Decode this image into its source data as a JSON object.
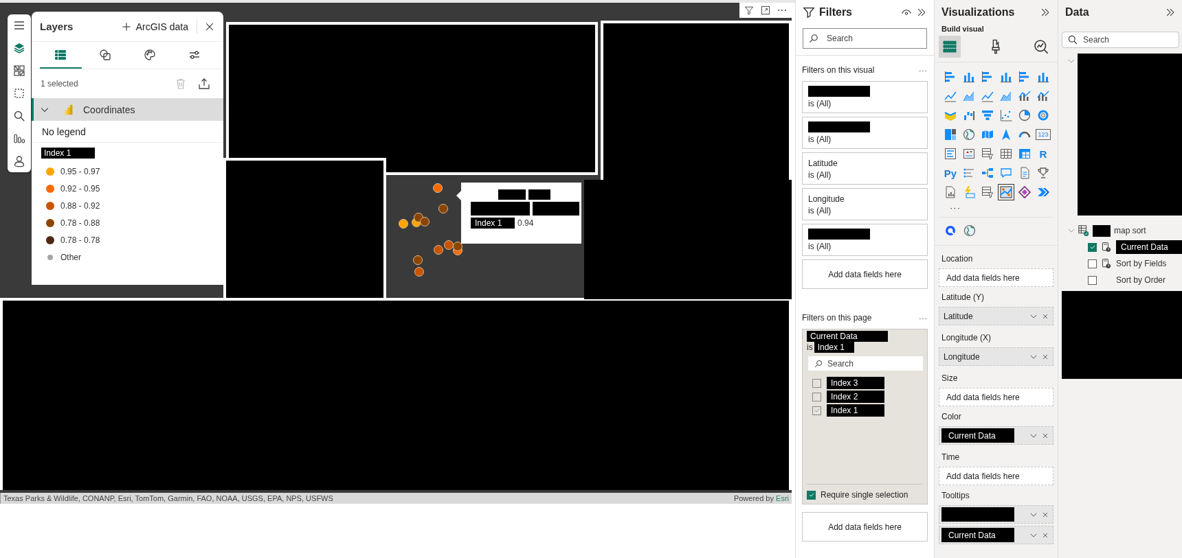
{
  "map_toolbar": [
    {
      "kind": "menu",
      "selected": false
    },
    {
      "kind": "layers",
      "selected": true
    },
    {
      "kind": "grid",
      "selected": false
    },
    {
      "kind": "select",
      "selected": false
    },
    {
      "kind": "search",
      "selected": false
    },
    {
      "kind": "bars",
      "selected": false
    },
    {
      "kind": "person",
      "selected": false
    }
  ],
  "layers_panel": {
    "title": "Layers",
    "add_button": "ArcGIS data",
    "tabs": [
      {
        "kind": "list",
        "selected": true
      },
      {
        "kind": "shapes",
        "selected": false
      },
      {
        "kind": "palette",
        "selected": false
      },
      {
        "kind": "sliders",
        "selected": false
      }
    ],
    "selection_count": "1 selected",
    "layer": {
      "name": "Coordinates",
      "expanded": true
    },
    "legend_note": "No legend",
    "legend_title": "Index 1",
    "legend_items": [
      {
        "label": "0.95 - 0.97",
        "color": "#ffa500"
      },
      {
        "label": "0.92 - 0.95",
        "color": "#ff6a00"
      },
      {
        "label": "0.88 - 0.92",
        "color": "#c85400"
      },
      {
        "label": "0.78 - 0.88",
        "color": "#8b4500"
      },
      {
        "label": "0.78 - 0.78",
        "color": "#4e2a14"
      },
      {
        "label": "Other",
        "color": "#a6a6a6"
      }
    ]
  },
  "tooltip": {
    "field": "Index 1",
    "value": "0.94"
  },
  "attribution": {
    "text": "Texas Parks & Wildlife, CONANP, Esri, TomTom, Garmin, FAO, NOAA, USGS, EPA, NPS, USFWS",
    "powered_by": "Powered by",
    "link": "Esri"
  },
  "filters": {
    "title": "Filters",
    "search_placeholder": "Search",
    "visual_section": "Filters on this visual",
    "visual_filters": [
      {
        "kind": "redacted",
        "condition": "is (All)"
      },
      {
        "kind": "redacted",
        "condition": "is (All)"
      },
      {
        "kind": "field",
        "field": "Latitude",
        "condition": "is (All)"
      },
      {
        "kind": "field",
        "field": "Longitude",
        "condition": "is (All)"
      },
      {
        "kind": "redacted",
        "condition": "is (All)"
      }
    ],
    "visual_add": "Add data fields here",
    "page_section": "Filters on this page",
    "page_filter": {
      "field": "Current Data",
      "is_label": "is",
      "value": "Index 1",
      "search_placeholder": "Search",
      "options": [
        {
          "label": "Index  3",
          "checked": false
        },
        {
          "label": "Index 2",
          "checked": false
        },
        {
          "label": "Index 1",
          "checked": true
        }
      ],
      "require_single": {
        "label": "Require single selection",
        "checked": true
      }
    },
    "page_add": "Add data fields here"
  },
  "visualizations": {
    "title": "Visualizations",
    "subtitle": "Build visual",
    "modes": [
      {
        "kind": "build",
        "selected": true
      },
      {
        "kind": "format",
        "selected": false
      },
      {
        "kind": "analytics",
        "selected": false
      }
    ],
    "visual_types": [
      {
        "kind": "hbar",
        "selected": false
      },
      {
        "kind": "vbar",
        "selected": false
      },
      {
        "kind": "hbar",
        "selected": false
      },
      {
        "kind": "vbar",
        "selected": false
      },
      {
        "kind": "hbar",
        "selected": false
      },
      {
        "kind": "vbar",
        "selected": false
      },
      {
        "kind": "line",
        "selected": false
      },
      {
        "kind": "area",
        "selected": false
      },
      {
        "kind": "line",
        "selected": false
      },
      {
        "kind": "area",
        "selected": false
      },
      {
        "kind": "combo",
        "selected": false
      },
      {
        "kind": "combo",
        "selected": false
      },
      {
        "kind": "ribbon",
        "selected": false
      },
      {
        "kind": "waterfall",
        "selected": false
      },
      {
        "kind": "funnel",
        "selected": false
      },
      {
        "kind": "scatter",
        "selected": false
      },
      {
        "kind": "pie",
        "selected": false
      },
      {
        "kind": "donut",
        "selected": false
      },
      {
        "kind": "treemap",
        "selected": false
      },
      {
        "kind": "globe",
        "selected": false
      },
      {
        "kind": "filledmap",
        "selected": false
      },
      {
        "kind": "arrow",
        "selected": false
      },
      {
        "kind": "gauge",
        "selected": false
      },
      {
        "kind": "card",
        "label": "123",
        "selected": false
      },
      {
        "kind": "rows",
        "selected": false
      },
      {
        "kind": "kpi",
        "selected": false
      },
      {
        "kind": "slicer",
        "selected": false
      },
      {
        "kind": "table",
        "selected": false
      },
      {
        "kind": "matrix",
        "selected": false
      },
      {
        "kind": "letter",
        "label": "R",
        "selected": false
      },
      {
        "kind": "letter",
        "label": "Py",
        "selected": false
      },
      {
        "kind": "influencers",
        "selected": false
      },
      {
        "kind": "decomp",
        "selected": false
      },
      {
        "kind": "bubble",
        "selected": false
      },
      {
        "kind": "doc",
        "selected": false
      },
      {
        "kind": "trophy",
        "selected": false
      },
      {
        "kind": "paginated",
        "selected": false
      },
      {
        "kind": "lightning",
        "selected": false
      },
      {
        "kind": "slicer",
        "selected": false
      },
      {
        "kind": "azuremap",
        "selected": true
      },
      {
        "kind": "diamond",
        "selected": false
      },
      {
        "kind": "chevron",
        "selected": false
      }
    ],
    "more": "···",
    "custom_visuals": [
      {
        "kind": "ring"
      },
      {
        "kind": "globe"
      }
    ],
    "wells": [
      {
        "label": "Location",
        "placeholder": "Add data fields here"
      },
      {
        "label": "Latitude (Y)",
        "fields": [
          {
            "label": "Latitude",
            "redacted": false
          }
        ]
      },
      {
        "label": "Longitude (X)",
        "fields": [
          {
            "label": "Longitude",
            "redacted": false
          }
        ]
      },
      {
        "label": "Size",
        "placeholder": "Add data fields here"
      },
      {
        "label": "Color",
        "fields": [
          {
            "label": "Current Data",
            "redacted": true
          }
        ]
      },
      {
        "label": "Time",
        "placeholder": "Add data fields here"
      },
      {
        "label": "Tooltips",
        "fields": [
          {
            "redacted": true
          },
          {
            "label": "Current Data",
            "redacted": true
          }
        ]
      }
    ]
  },
  "data": {
    "title": "Data",
    "search_placeholder": "Search",
    "tables": [
      {
        "redacted": true,
        "expanded": true
      },
      {
        "name": "map sort",
        "expanded": true,
        "children": [
          {
            "name": "Current Data",
            "kind": "measure",
            "checked": true,
            "redacted": true
          },
          {
            "name": "Sort by Fields",
            "kind": "measure",
            "checked": false,
            "redacted": false
          },
          {
            "name": "Sort by Order",
            "kind": "column",
            "checked": false,
            "redacted": false
          }
        ]
      },
      {
        "redacted": true
      }
    ]
  }
}
